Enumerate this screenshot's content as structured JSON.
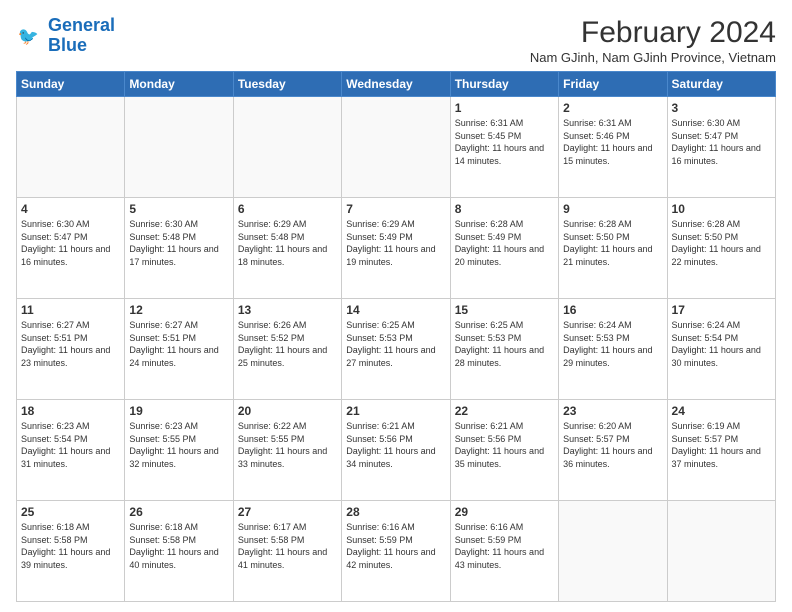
{
  "logo": {
    "line1": "General",
    "line2": "Blue"
  },
  "title": "February 2024",
  "subtitle": "Nam GJinh, Nam GJinh Province, Vietnam",
  "days_header": [
    "Sunday",
    "Monday",
    "Tuesday",
    "Wednesday",
    "Thursday",
    "Friday",
    "Saturday"
  ],
  "weeks": [
    [
      {
        "day": "",
        "info": ""
      },
      {
        "day": "",
        "info": ""
      },
      {
        "day": "",
        "info": ""
      },
      {
        "day": "",
        "info": ""
      },
      {
        "day": "1",
        "info": "Sunrise: 6:31 AM\nSunset: 5:45 PM\nDaylight: 11 hours and 14 minutes."
      },
      {
        "day": "2",
        "info": "Sunrise: 6:31 AM\nSunset: 5:46 PM\nDaylight: 11 hours and 15 minutes."
      },
      {
        "day": "3",
        "info": "Sunrise: 6:30 AM\nSunset: 5:47 PM\nDaylight: 11 hours and 16 minutes."
      }
    ],
    [
      {
        "day": "4",
        "info": "Sunrise: 6:30 AM\nSunset: 5:47 PM\nDaylight: 11 hours and 16 minutes."
      },
      {
        "day": "5",
        "info": "Sunrise: 6:30 AM\nSunset: 5:48 PM\nDaylight: 11 hours and 17 minutes."
      },
      {
        "day": "6",
        "info": "Sunrise: 6:29 AM\nSunset: 5:48 PM\nDaylight: 11 hours and 18 minutes."
      },
      {
        "day": "7",
        "info": "Sunrise: 6:29 AM\nSunset: 5:49 PM\nDaylight: 11 hours and 19 minutes."
      },
      {
        "day": "8",
        "info": "Sunrise: 6:28 AM\nSunset: 5:49 PM\nDaylight: 11 hours and 20 minutes."
      },
      {
        "day": "9",
        "info": "Sunrise: 6:28 AM\nSunset: 5:50 PM\nDaylight: 11 hours and 21 minutes."
      },
      {
        "day": "10",
        "info": "Sunrise: 6:28 AM\nSunset: 5:50 PM\nDaylight: 11 hours and 22 minutes."
      }
    ],
    [
      {
        "day": "11",
        "info": "Sunrise: 6:27 AM\nSunset: 5:51 PM\nDaylight: 11 hours and 23 minutes."
      },
      {
        "day": "12",
        "info": "Sunrise: 6:27 AM\nSunset: 5:51 PM\nDaylight: 11 hours and 24 minutes."
      },
      {
        "day": "13",
        "info": "Sunrise: 6:26 AM\nSunset: 5:52 PM\nDaylight: 11 hours and 25 minutes."
      },
      {
        "day": "14",
        "info": "Sunrise: 6:25 AM\nSunset: 5:53 PM\nDaylight: 11 hours and 27 minutes."
      },
      {
        "day": "15",
        "info": "Sunrise: 6:25 AM\nSunset: 5:53 PM\nDaylight: 11 hours and 28 minutes."
      },
      {
        "day": "16",
        "info": "Sunrise: 6:24 AM\nSunset: 5:53 PM\nDaylight: 11 hours and 29 minutes."
      },
      {
        "day": "17",
        "info": "Sunrise: 6:24 AM\nSunset: 5:54 PM\nDaylight: 11 hours and 30 minutes."
      }
    ],
    [
      {
        "day": "18",
        "info": "Sunrise: 6:23 AM\nSunset: 5:54 PM\nDaylight: 11 hours and 31 minutes."
      },
      {
        "day": "19",
        "info": "Sunrise: 6:23 AM\nSunset: 5:55 PM\nDaylight: 11 hours and 32 minutes."
      },
      {
        "day": "20",
        "info": "Sunrise: 6:22 AM\nSunset: 5:55 PM\nDaylight: 11 hours and 33 minutes."
      },
      {
        "day": "21",
        "info": "Sunrise: 6:21 AM\nSunset: 5:56 PM\nDaylight: 11 hours and 34 minutes."
      },
      {
        "day": "22",
        "info": "Sunrise: 6:21 AM\nSunset: 5:56 PM\nDaylight: 11 hours and 35 minutes."
      },
      {
        "day": "23",
        "info": "Sunrise: 6:20 AM\nSunset: 5:57 PM\nDaylight: 11 hours and 36 minutes."
      },
      {
        "day": "24",
        "info": "Sunrise: 6:19 AM\nSunset: 5:57 PM\nDaylight: 11 hours and 37 minutes."
      }
    ],
    [
      {
        "day": "25",
        "info": "Sunrise: 6:18 AM\nSunset: 5:58 PM\nDaylight: 11 hours and 39 minutes."
      },
      {
        "day": "26",
        "info": "Sunrise: 6:18 AM\nSunset: 5:58 PM\nDaylight: 11 hours and 40 minutes."
      },
      {
        "day": "27",
        "info": "Sunrise: 6:17 AM\nSunset: 5:58 PM\nDaylight: 11 hours and 41 minutes."
      },
      {
        "day": "28",
        "info": "Sunrise: 6:16 AM\nSunset: 5:59 PM\nDaylight: 11 hours and 42 minutes."
      },
      {
        "day": "29",
        "info": "Sunrise: 6:16 AM\nSunset: 5:59 PM\nDaylight: 11 hours and 43 minutes."
      },
      {
        "day": "",
        "info": ""
      },
      {
        "day": "",
        "info": ""
      }
    ]
  ]
}
